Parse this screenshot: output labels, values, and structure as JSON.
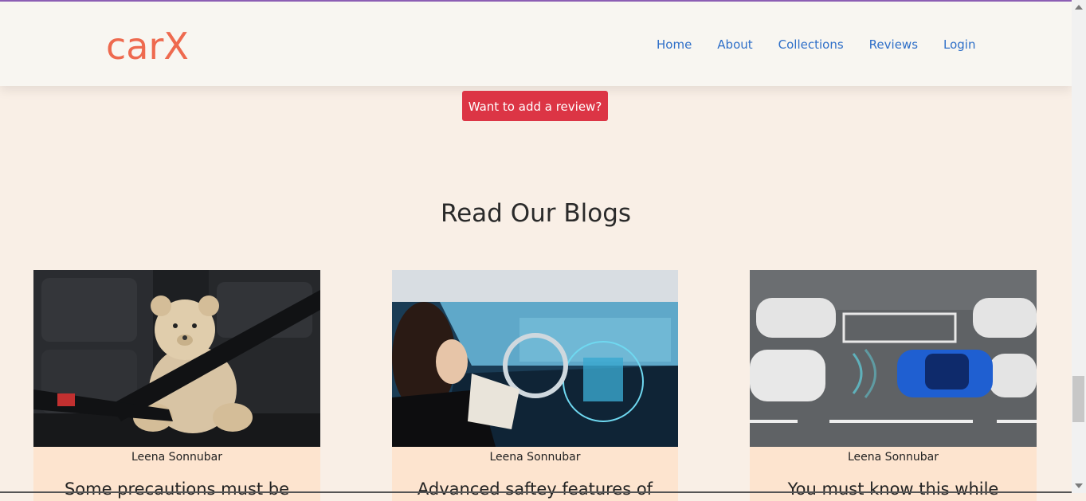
{
  "brand": {
    "name": "carX",
    "color": "#ee6a4f"
  },
  "nav": {
    "items": [
      {
        "label": "Home"
      },
      {
        "label": "About"
      },
      {
        "label": "Collections"
      },
      {
        "label": "Reviews"
      },
      {
        "label": "Login"
      }
    ],
    "link_color": "#2e6fc8"
  },
  "review_button": {
    "label": "Want to add a review?",
    "color": "#dc3545"
  },
  "blogs": {
    "title": "Read Our Blogs",
    "cards": [
      {
        "author": "Leena Sonnubar",
        "title": "Some precautions must be",
        "image": "teddy-bear-seatbelt-image"
      },
      {
        "author": "Leena Sonnubar",
        "title": "Advanced saftey features of",
        "image": "self-driving-car-interior-image"
      },
      {
        "author": "Leena Sonnubar",
        "title": "You must know this while",
        "image": "parking-sensor-car-image"
      }
    ]
  },
  "colors": {
    "page_background": "#f9efe6",
    "card_background": "#fde4cf",
    "navbar_background": "#f8f6f1"
  }
}
